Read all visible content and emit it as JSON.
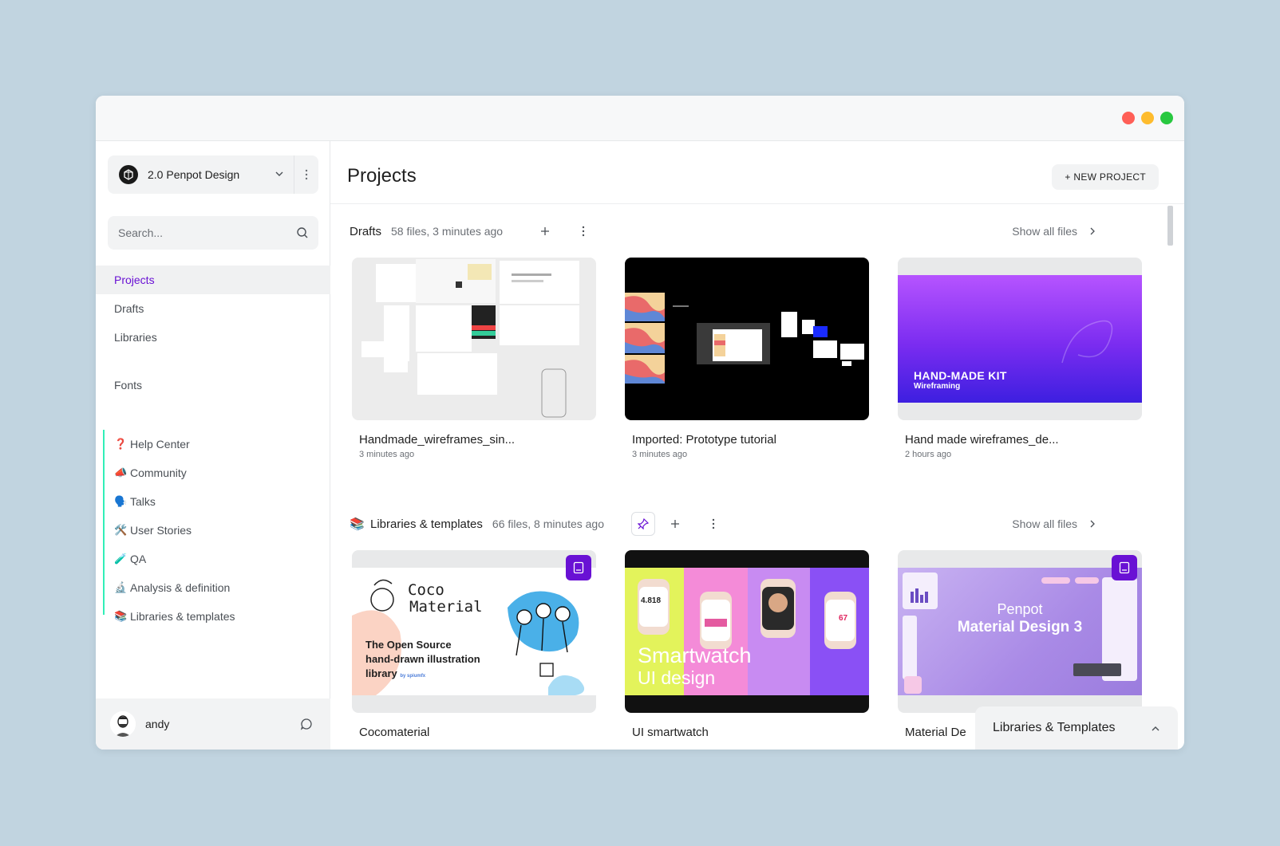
{
  "colors": {
    "accent": "#6911d4",
    "pin_bar": "#31efb8",
    "close": "#ff5f57",
    "minimize": "#febc2e",
    "maximize": "#28c840"
  },
  "sidebar": {
    "team_name": "2.0 Penpot Design",
    "search_placeholder": "Search...",
    "nav": [
      "Projects",
      "Drafts",
      "Libraries"
    ],
    "fonts_label": "Fonts",
    "pinned": [
      {
        "emoji": "❓",
        "label": "Help Center"
      },
      {
        "emoji": "📣",
        "label": "Community"
      },
      {
        "emoji": "🗣️",
        "label": "Talks"
      },
      {
        "emoji": "🛠️",
        "label": "User Stories"
      },
      {
        "emoji": "🧪",
        "label": "QA"
      },
      {
        "emoji": "🔬",
        "label": "Analysis & definition"
      },
      {
        "emoji": "📚",
        "label": "Libraries & templates"
      }
    ],
    "user_name": "andy"
  },
  "main": {
    "title": "Projects",
    "new_project_label": "+ NEW PROJECT",
    "drafts": {
      "title": "Drafts",
      "meta": "58 files, 3 minutes ago",
      "show_all": "Show all files",
      "files": [
        {
          "name": "Handmade_wireframes_sin...",
          "time": "3 minutes ago"
        },
        {
          "name": "Imported: Prototype tutorial",
          "time": "3 minutes ago"
        },
        {
          "name": "Hand made wireframes_de...",
          "time": "2 hours ago"
        }
      ]
    },
    "libraries": {
      "emoji": "📚",
      "title": "Libraries & templates",
      "meta": "66 files, 8 minutes ago",
      "show_all": "Show all files",
      "files": [
        {
          "name": "Cocomaterial"
        },
        {
          "name": "UI smartwatch"
        },
        {
          "name": "Material De"
        }
      ]
    },
    "thumbs": {
      "handmade_kit_title": "HAND-MADE KIT",
      "handmade_kit_sub": "Wireframing",
      "coco_title_1": "Coco",
      "coco_title_2": "Material",
      "coco_desc_1": "The Open Source",
      "coco_desc_2": "hand-drawn illustration",
      "coco_desc_3": "library",
      "coco_by": "by spiumfx",
      "watch_title_1": "Smartwatch",
      "watch_title_2": "UI design",
      "watch_steps": "4.818",
      "watch_bpm": "67",
      "md_title_1": "Penpot",
      "md_title_2": "Material Design 3"
    },
    "bottom_panel_label": "Libraries & Templates"
  }
}
